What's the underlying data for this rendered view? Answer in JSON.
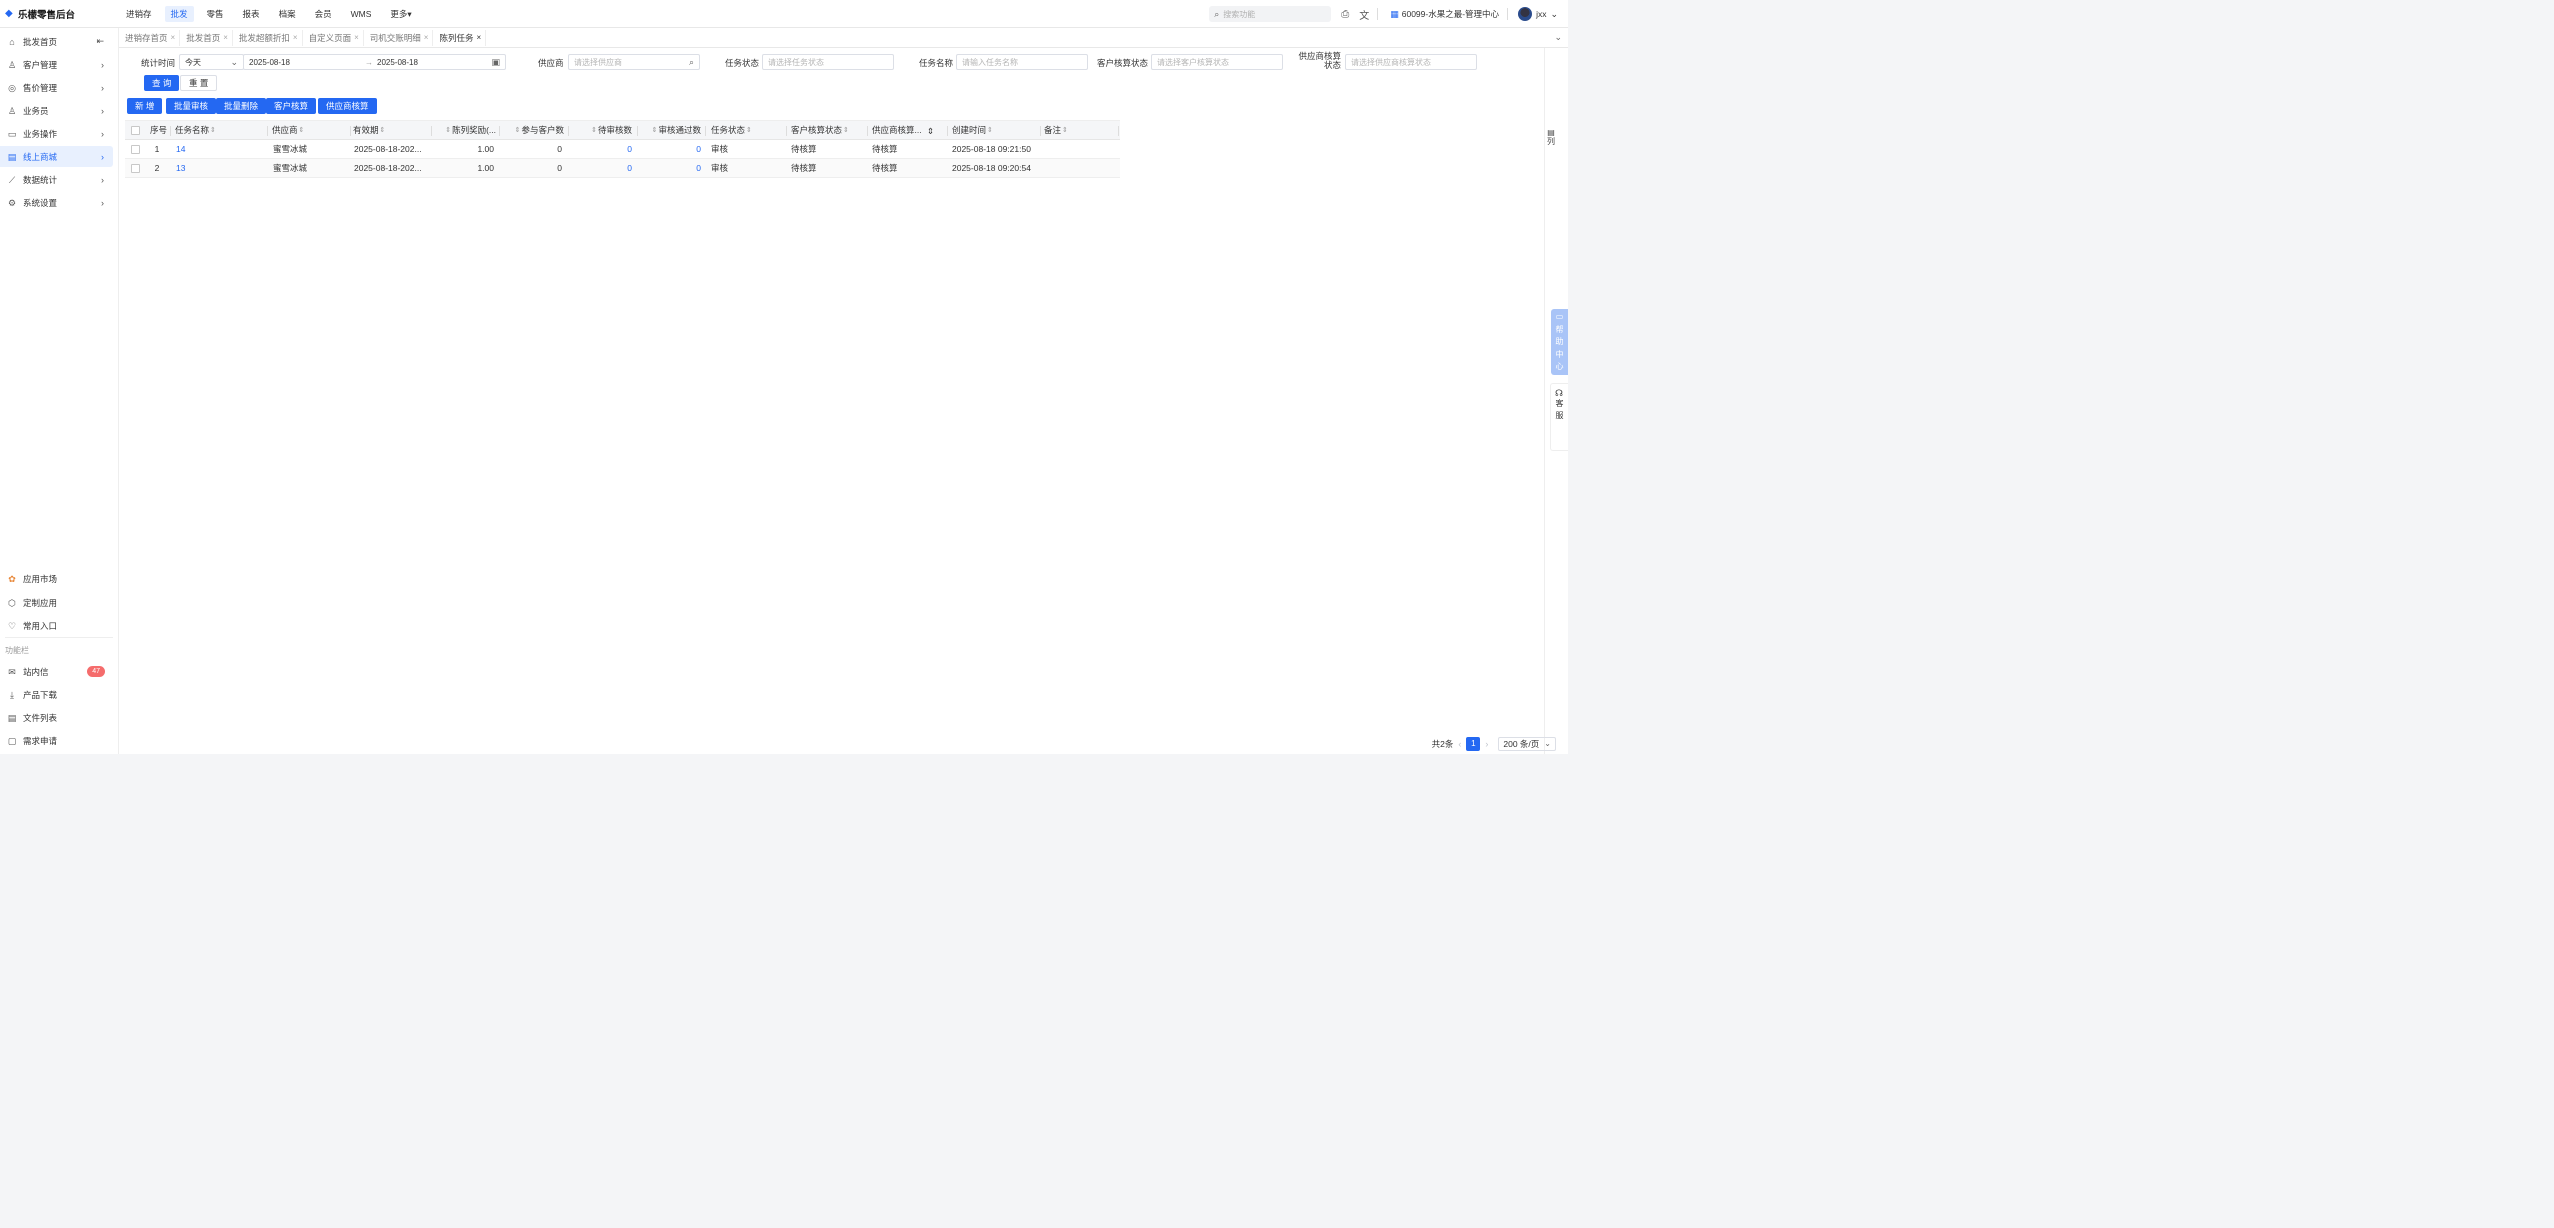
{
  "app": {
    "title": "乐檬零售后台"
  },
  "topnav": [
    "进销存",
    "批发",
    "零售",
    "报表",
    "档案",
    "会员",
    "WMS",
    "更多"
  ],
  "topright": {
    "search_placeholder": "搜索功能",
    "store": "60099-水果之最-管理中心",
    "user": "jxx"
  },
  "sidebar": {
    "items": [
      "批发首页",
      "客户管理",
      "售价管理",
      "业务员",
      "业务操作",
      "线上商城",
      "数据统计",
      "系统设置"
    ],
    "bottom_items": [
      "应用市场",
      "定制应用",
      "常用入口"
    ],
    "func_caption": "功能栏",
    "func_items": [
      "站内信",
      "产品下载",
      "文件列表",
      "需求申请"
    ],
    "message_badge": "47"
  },
  "tabs": [
    "进销存首页",
    "批发首页",
    "批发超额折扣",
    "自定义页面",
    "司机交账明细",
    "陈列任务"
  ],
  "filters": {
    "stat_time_label": "统计时间",
    "stat_time_value": "今天",
    "date_start": "2025-08-18",
    "date_sep": "→",
    "date_end": "2025-08-18",
    "supplier_label": "供应商",
    "supplier_placeholder": "请选择供应商",
    "task_status_label": "任务状态",
    "task_status_placeholder": "请选择任务状态",
    "task_name_label": "任务名称",
    "task_name_placeholder": "请输入任务名称",
    "customer_settle_label": "客户核算状态",
    "customer_settle_placeholder": "请选择客户核算状态",
    "supplier_settle_label": "供应商核算状态",
    "supplier_settle_placeholder": "请选择供应商核算状态",
    "query_btn": "查 询",
    "reset_btn": "重 置"
  },
  "actions": [
    "新 增",
    "批量审核",
    "批量删除",
    "客户核算",
    "供应商核算"
  ],
  "table": {
    "headers": [
      "序号",
      "任务名称",
      "供应商",
      "有效期",
      "陈列奖励(...",
      "参与客户数",
      "待审核数",
      "审核通过数",
      "任务状态",
      "客户核算状态",
      "供应商核算...",
      "创建时间",
      "备注"
    ],
    "rows": [
      {
        "no": "1",
        "name": "14",
        "supplier": "蜜雪冰城",
        "validity": "2025-08-18-202...",
        "reward": "1.00",
        "customers": "0",
        "pending": "0",
        "approved": "0",
        "status": "审核",
        "cust_settle": "待核算",
        "supp_settle": "待核算",
        "created": "2025-08-18 09:21:50",
        "remark": ""
      },
      {
        "no": "2",
        "name": "13",
        "supplier": "蜜雪冰城",
        "validity": "2025-08-18-202...",
        "reward": "1.00",
        "customers": "0",
        "pending": "0",
        "approved": "0",
        "status": "审核",
        "cust_settle": "待核算",
        "supp_settle": "待核算",
        "created": "2025-08-18 09:20:54",
        "remark": ""
      }
    ]
  },
  "right": {
    "columns_toggle": "列",
    "help": "帮助中心",
    "service": "客服"
  },
  "pager": {
    "total": "共2条",
    "page": "1",
    "size": "200 条/页"
  },
  "colors": {
    "primary": "#2468f2",
    "badge": "#f56c6c",
    "active_bg": "#e8f0fe"
  }
}
